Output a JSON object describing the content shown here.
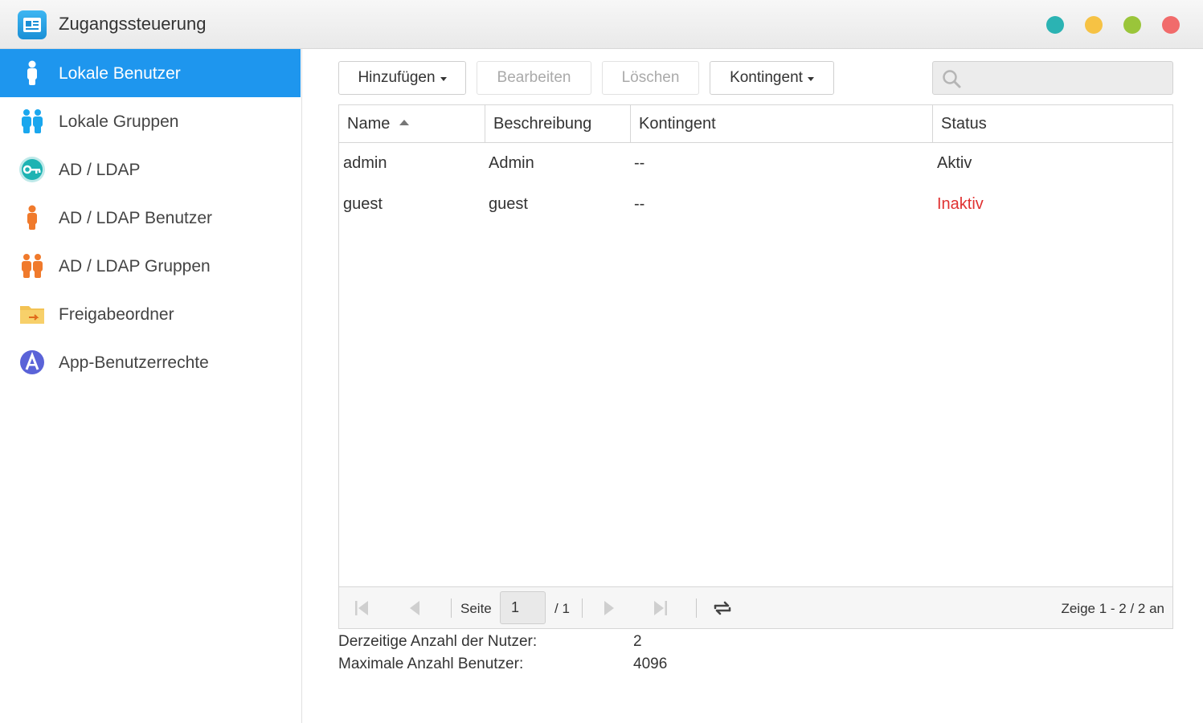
{
  "window": {
    "title": "Zugangssteuerung",
    "controls": [
      {
        "name": "window-teal-button",
        "color": "#2bb3b3"
      },
      {
        "name": "window-minimize-button",
        "color": "#f6c244"
      },
      {
        "name": "window-maximize-button",
        "color": "#9ac53a"
      },
      {
        "name": "window-close-button",
        "color": "#f16b6b"
      }
    ]
  },
  "sidebar": {
    "items": [
      {
        "label": "Lokale Benutzer",
        "icon": "local-user-icon",
        "active": true
      },
      {
        "label": "Lokale Gruppen",
        "icon": "local-group-icon",
        "active": false
      },
      {
        "label": "AD / LDAP",
        "icon": "key-icon",
        "active": false
      },
      {
        "label": "AD / LDAP Benutzer",
        "icon": "ldap-user-icon",
        "active": false
      },
      {
        "label": "AD / LDAP Gruppen",
        "icon": "ldap-group-icon",
        "active": false
      },
      {
        "label": "Freigabeordner",
        "icon": "shared-folder-icon",
        "active": false
      },
      {
        "label": "App-Benutzerrechte",
        "icon": "app-privilege-icon",
        "active": false
      }
    ]
  },
  "toolbar": {
    "add_label": "Hinzufügen",
    "edit_label": "Bearbeiten",
    "delete_label": "Löschen",
    "quota_label": "Kontingent",
    "search_placeholder": ""
  },
  "table": {
    "columns": [
      "Name",
      "Beschreibung",
      "Kontingent",
      "Status"
    ],
    "rows": [
      {
        "name": "admin",
        "description": "Admin",
        "quota": "--",
        "status": "Aktiv"
      },
      {
        "name": "guest",
        "description": "guest",
        "quota": "--",
        "status": "Inaktiv"
      }
    ]
  },
  "pager": {
    "page_label": "Seite",
    "page_value": "1",
    "page_total": "/ 1",
    "summary": "Zeige 1 - 2 / 2 an"
  },
  "info": {
    "current_label": "Derzeitige Anzahl der Nutzer:",
    "current_value": "2",
    "max_label": "Maximale Anzahl Benutzer:",
    "max_value": "4096"
  },
  "colors": {
    "accent": "#1e96ee",
    "inactive": "#e03131"
  }
}
